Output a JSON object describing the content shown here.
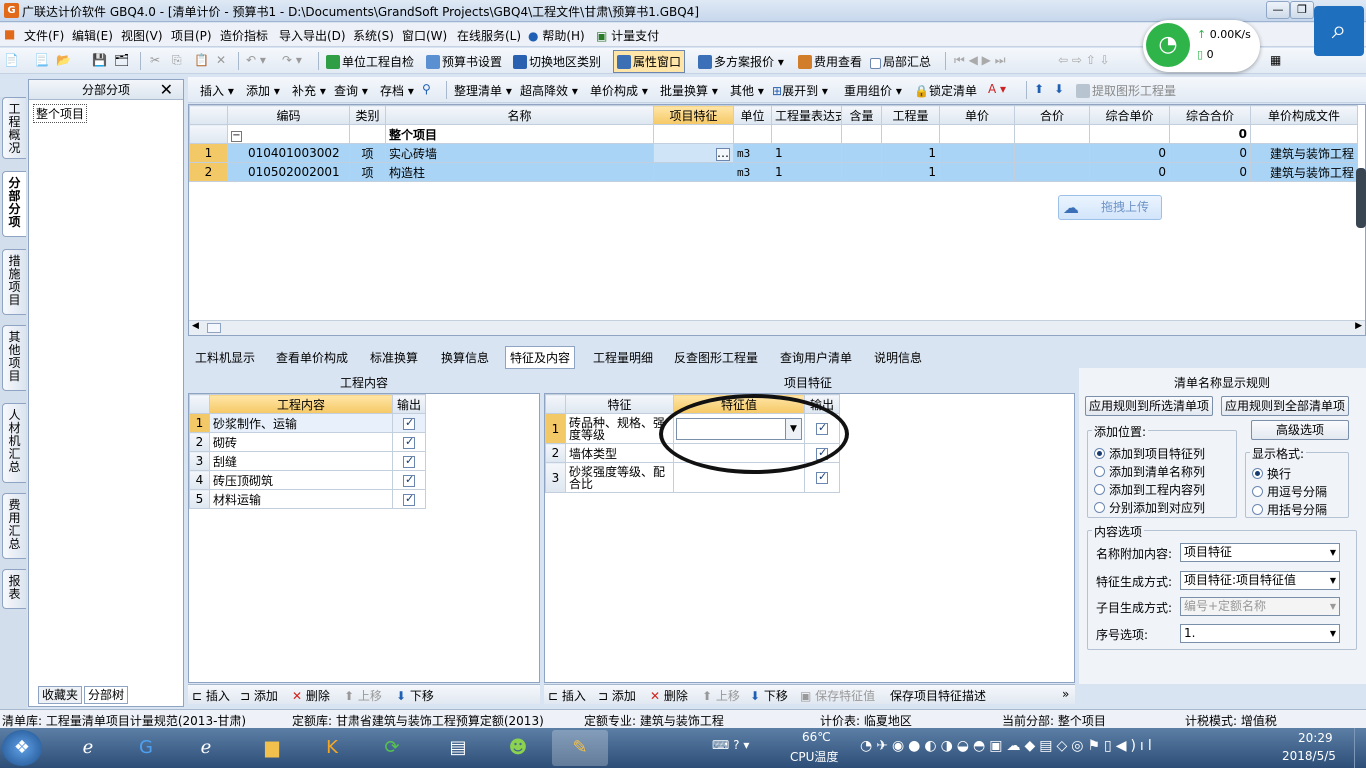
{
  "window": {
    "title": "广联达计价软件 GBQ4.0 - [清单计价 - 预算书1 - D:\\Documents\\GrandSoft Projects\\GBQ4\\工程文件\\甘肃\\预算书1.GBQ4]"
  },
  "menu": [
    "文件(F)",
    "编辑(E)",
    "视图(V)",
    "项目(P)",
    "造价指标",
    "导入导出(D)",
    "系统(S)",
    "窗口(W)",
    "在线服务(L)",
    "帮助(H)",
    "计量支付"
  ],
  "toolbar1": {
    "check": "单位工程自检",
    "settings": "预算书设置",
    "switch_region": "切换地区类别",
    "attr_window": "属性窗口",
    "multi_plan": "多方案报价",
    "fee_view": "费用查看",
    "partial_sum": "局部汇总"
  },
  "toolbar2": {
    "insert": "插入",
    "add": "添加",
    "supplement": "补充",
    "query": "查询",
    "save": "存档",
    "organize": "整理清单",
    "super_drop": "超高降效",
    "unit_price": "单价构成",
    "batch_convert": "批量换算",
    "other": "其他",
    "expand": "展开到",
    "recompose": "重用组价",
    "lock": "锁定清单",
    "extract": "提取图形工程量"
  },
  "network": {
    "speed": "0.00K/s",
    "count": "0"
  },
  "left_tabs": [
    "工程概况",
    "分部分项",
    "措施项目",
    "其他项目",
    "人材机汇总",
    "费用汇总",
    "报表"
  ],
  "tree": {
    "header": "分部分项",
    "root": "整个项目",
    "tab_fav": "收藏夹",
    "tab_tree": "分部树"
  },
  "grid": {
    "columns": [
      "编码",
      "类别",
      "名称",
      "项目特征",
      "单位",
      "工程量表达式",
      "含量",
      "工程量",
      "单价",
      "合价",
      "综合单价",
      "综合合价",
      "单价构成文件"
    ],
    "group_row": {
      "name": "整个项目",
      "total": "0"
    },
    "rows": [
      {
        "no": "1",
        "code": "010401003002",
        "type": "项",
        "name": "实心砖墙",
        "unit": "m3",
        "expr": "1",
        "qty": "1",
        "comp_price": "0",
        "comp_total": "0",
        "file": "建筑与装饰工程"
      },
      {
        "no": "2",
        "code": "010502002001",
        "type": "项",
        "name": "构造柱",
        "unit": "m3",
        "expr": "1",
        "qty": "1",
        "comp_price": "0",
        "comp_total": "0",
        "file": "建筑与装饰工程"
      }
    ]
  },
  "upload_button": "拖拽上传",
  "lower_tabs": [
    "工料机显示",
    "查看单价构成",
    "标准换算",
    "换算信息",
    "特征及内容",
    "工程量明细",
    "反查图形工程量",
    "查询用户清单",
    "说明信息"
  ],
  "work_content": {
    "title": "工程内容",
    "col_content": "工程内容",
    "col_output": "输出",
    "rows": [
      {
        "no": "1",
        "text": "砂浆制作、运输"
      },
      {
        "no": "2",
        "text": "砌砖"
      },
      {
        "no": "3",
        "text": "刮缝"
      },
      {
        "no": "4",
        "text": "砖压顶砌筑"
      },
      {
        "no": "5",
        "text": "材料运输"
      }
    ]
  },
  "features": {
    "title": "项目特征",
    "col_feature": "特征",
    "col_value": "特征值",
    "col_output": "输出",
    "rows": [
      {
        "no": "1",
        "text": "砖品种、规格、强度等级"
      },
      {
        "no": "2",
        "text": "墙体类型"
      },
      {
        "no": "3",
        "text": "砂浆强度等级、配合比"
      }
    ]
  },
  "bottom_buttons_left": {
    "insert": "插入",
    "add": "添加",
    "delete": "删除",
    "up": "上移",
    "down": "下移"
  },
  "bottom_buttons_mid": {
    "insert": "插入",
    "add": "添加",
    "delete": "删除",
    "up": "上移",
    "down": "下移",
    "save_feature": "保存特征值",
    "save_desc": "保存项目特征描述"
  },
  "rules": {
    "title": "清单名称显示规则",
    "apply_selected": "应用规则到所选清单项",
    "apply_all": "应用规则到全部清单项",
    "advanced": "高级选项",
    "add_pos_label": "添加位置:",
    "add_pos": [
      "添加到项目特征列",
      "添加到清单名称列",
      "添加到工程内容列",
      "分别添加到对应列"
    ],
    "format_label": "显示格式:",
    "format": [
      "换行",
      "用逗号分隔",
      "用括号分隔"
    ],
    "content_label": "内容选项",
    "name_append_label": "名称附加内容:",
    "name_append": "项目特征",
    "feature_gen_label": "特征生成方式:",
    "feature_gen": "项目特征:项目特征值",
    "sub_gen_label": "子目生成方式:",
    "sub_gen": "编号+定额名称",
    "seq_label": "序号选项:",
    "seq": "1."
  },
  "status": {
    "list_lib": "清单库:  工程量清单项目计量规范(2013-甘肃)",
    "quota_lib": "定额库:  甘肃省建筑与装饰工程预算定额(2013)",
    "quota_major": "定额专业:  建筑与装饰工程",
    "price_table": "计价表:  临夏地区",
    "current": "当前分部:  整个项目",
    "tax": "计税模式:  增值税"
  },
  "taskbar": {
    "temp": "66℃",
    "temp_label": "CPU温度",
    "time": "20:29",
    "date": "2018/5/5"
  }
}
